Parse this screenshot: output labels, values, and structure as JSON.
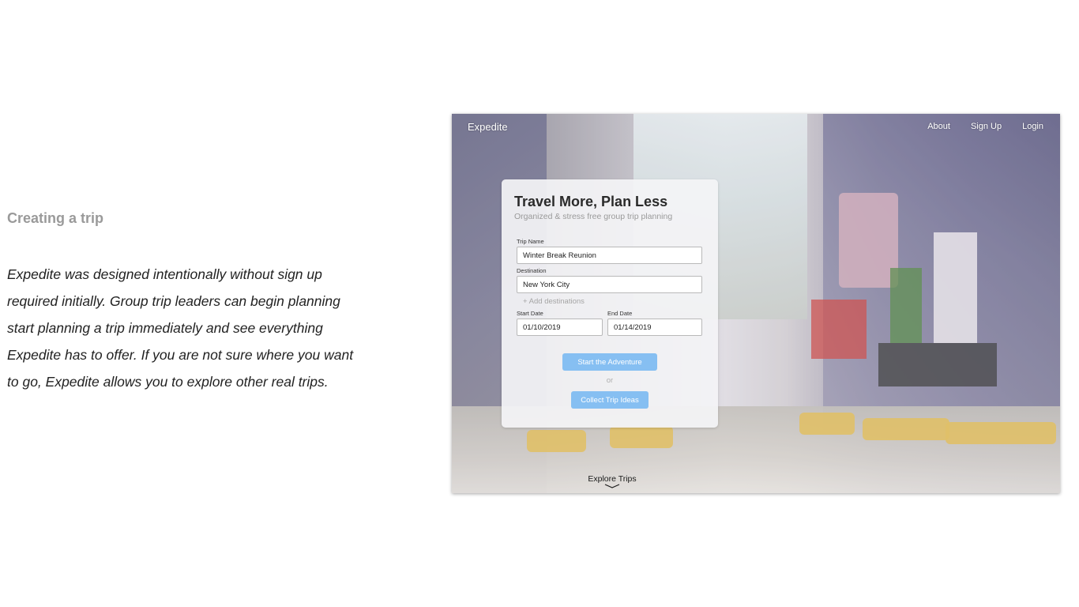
{
  "section": {
    "title": "Creating a trip",
    "description": "Expedite was designed intentionally without sign up required initially. Group trip leaders can begin planning start planning a trip immediately and see everything Expedite has to offer. If you are not sure where you want to go, Expedite allows you to explore other real trips."
  },
  "app": {
    "brand": "Expedite",
    "nav": {
      "about": "About",
      "signup": "Sign Up",
      "login": "Login"
    },
    "card": {
      "title": "Travel More, Plan Less",
      "subtitle": "Organized & stress free group trip planning",
      "trip_name": {
        "label": "Trip Name",
        "value": "Winter Break Reunion"
      },
      "destination": {
        "label": "Destination",
        "value": "New York City"
      },
      "add_destinations": "+ Add destinations",
      "start_date": {
        "label": "Start Date",
        "value": "01/10/2019"
      },
      "end_date": {
        "label": "End Date",
        "value": "01/14/2019"
      },
      "start_button": "Start the Adventure",
      "or": "or",
      "collect_button": "Collect Trip Ideas"
    },
    "explore": {
      "label": "Explore Trips",
      "icon": "chevron-down-icon"
    },
    "colors": {
      "button": "#86bff2",
      "card": "#f4f4f6"
    }
  }
}
